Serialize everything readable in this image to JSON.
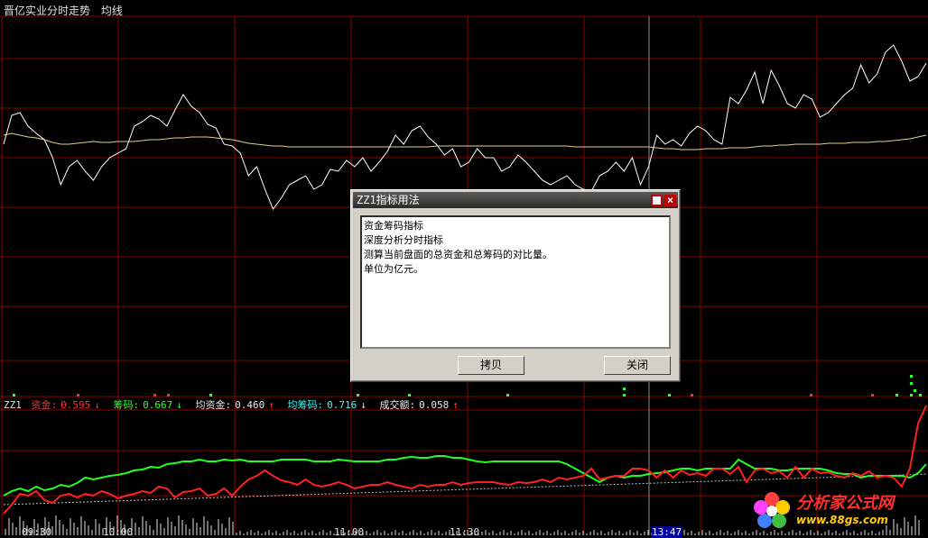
{
  "title": {
    "stock": "晋亿实业分时走势",
    "avg_label": "均线"
  },
  "indicator": {
    "name": "ZZ1",
    "items": [
      {
        "label": "资金:",
        "value": "0.595",
        "arrow": "↓",
        "color": "#ff3030"
      },
      {
        "label": "筹码:",
        "value": "0.667",
        "arrow": "↓",
        "color": "#30ff30"
      },
      {
        "label": "均资金:",
        "value": "0.460",
        "arrow": "↑",
        "color": "#e8e8e8"
      },
      {
        "label": "均筹码:",
        "value": "0.716",
        "arrow": "↓",
        "color": "#30ffff"
      },
      {
        "label": "成交额:",
        "value": "0.058",
        "arrow": "↑",
        "color": "#e8e8e8"
      }
    ]
  },
  "time_axis": [
    "09:30",
    "10:00",
    "11:00",
    "11:30",
    "13:47"
  ],
  "dialog": {
    "title": "ZZ1指标用法",
    "lines": [
      "资金筹码指标",
      "深度分析分时指标",
      "测算当前盘面的总资金和总筹码的对比量。",
      "单位为亿元。"
    ],
    "copy_button": "拷贝",
    "close_button": "关闭"
  },
  "watermark": {
    "name": "分析家公式网",
    "url": "www.88gs.com"
  },
  "colors": {
    "grid": "#8b0000",
    "price_line": "#ffffff",
    "avg_line": "#e0d090",
    "capital_line": "#ff2020",
    "chips_line": "#20ff20",
    "avg_chips_line": "#c0c0c0",
    "cursor": "#909090"
  },
  "chart_data": {
    "type": "line",
    "price": [
      160,
      128,
      125,
      140,
      148,
      155,
      175,
      205,
      185,
      178,
      190,
      200,
      185,
      175,
      170,
      165,
      140,
      135,
      128,
      132,
      140,
      122,
      105,
      118,
      125,
      138,
      142,
      160,
      162,
      170,
      195,
      185,
      210,
      232,
      220,
      205,
      200,
      195,
      210,
      205,
      188,
      190,
      178,
      185,
      175,
      190,
      180,
      168,
      150,
      160,
      145,
      140,
      152,
      160,
      172,
      165,
      185,
      180,
      165,
      175,
      175,
      190,
      185,
      172,
      180,
      190,
      200,
      205,
      200,
      195,
      205,
      210,
      212,
      195,
      190,
      180,
      190,
      175,
      205,
      185,
      150,
      160,
      155,
      162,
      148,
      140,
      145,
      155,
      160,
      108,
      115,
      100,
      80,
      115,
      78,
      95,
      115,
      120,
      105,
      110,
      130,
      125,
      115,
      105,
      98,
      72,
      92,
      82,
      58,
      50,
      68,
      90,
      85,
      70
    ],
    "avg": [
      150,
      148,
      150,
      152,
      153,
      155,
      158,
      160,
      160,
      159,
      158,
      157,
      158,
      158,
      157,
      157,
      157,
      156,
      155,
      155,
      154,
      153,
      153,
      152,
      152,
      152,
      153,
      154,
      155,
      157,
      159,
      160,
      161,
      162,
      162,
      163,
      163,
      163,
      163,
      163,
      163,
      163,
      163,
      163,
      163,
      163,
      163,
      163,
      163,
      163,
      163,
      163,
      163,
      162,
      162,
      162,
      162,
      162,
      162,
      162,
      162,
      162,
      162,
      162,
      162,
      162,
      162,
      162,
      162,
      162,
      163,
      163,
      163,
      163,
      163,
      163,
      163,
      163,
      163,
      163,
      164,
      165,
      165,
      166,
      166,
      166,
      165,
      165,
      165,
      164,
      164,
      164,
      163,
      162,
      162,
      161,
      161,
      160,
      160,
      160,
      160,
      159,
      159,
      159,
      158,
      158,
      158,
      157,
      157,
      156,
      155,
      154,
      152,
      150
    ],
    "capital": [
      570,
      560,
      548,
      550,
      545,
      555,
      558,
      550,
      548,
      552,
      548,
      550,
      545,
      548,
      553,
      550,
      548,
      545,
      547,
      540,
      542,
      552,
      546,
      545,
      542,
      550,
      548,
      542,
      550,
      540,
      532,
      528,
      522,
      528,
      533,
      535,
      538,
      532,
      538,
      540,
      538,
      535,
      538,
      542,
      540,
      538,
      538,
      535,
      538,
      540,
      542,
      538,
      540,
      538,
      538,
      535,
      538,
      536,
      535,
      535,
      535,
      537,
      538,
      535,
      536,
      535,
      532,
      535,
      530,
      532,
      530,
      528,
      520,
      532,
      530,
      528,
      528,
      520,
      520,
      522,
      530,
      522,
      530,
      522,
      527,
      525,
      528,
      520,
      520,
      526,
      518,
      535,
      522,
      520,
      525,
      523,
      530,
      518,
      530,
      520,
      525,
      524,
      528,
      530,
      525,
      528,
      523,
      530,
      528,
      530,
      540,
      520,
      470,
      450
    ],
    "chips": [
      550,
      545,
      542,
      545,
      540,
      544,
      542,
      538,
      540,
      536,
      530,
      532,
      530,
      528,
      527,
      525,
      522,
      521,
      518,
      519,
      515,
      514,
      512,
      512,
      510,
      512,
      512,
      510,
      511,
      510,
      512,
      512,
      512,
      512,
      510,
      510,
      510,
      510,
      512,
      512,
      512,
      510,
      511,
      512,
      512,
      512,
      512,
      510,
      510,
      508,
      507,
      508,
      508,
      506,
      506,
      508,
      508,
      510,
      512,
      513,
      512,
      512,
      512,
      512,
      512,
      512,
      512,
      512,
      512,
      515,
      520,
      525,
      530,
      535,
      530,
      528,
      530,
      528,
      528,
      526,
      525,
      524,
      522,
      520,
      520,
      522,
      520,
      520,
      520,
      520,
      510,
      515,
      520,
      520,
      520,
      522,
      522,
      520,
      520,
      520,
      520,
      522,
      525,
      526,
      526,
      530,
      528,
      528,
      528,
      528,
      528,
      530,
      525,
      515
    ]
  }
}
